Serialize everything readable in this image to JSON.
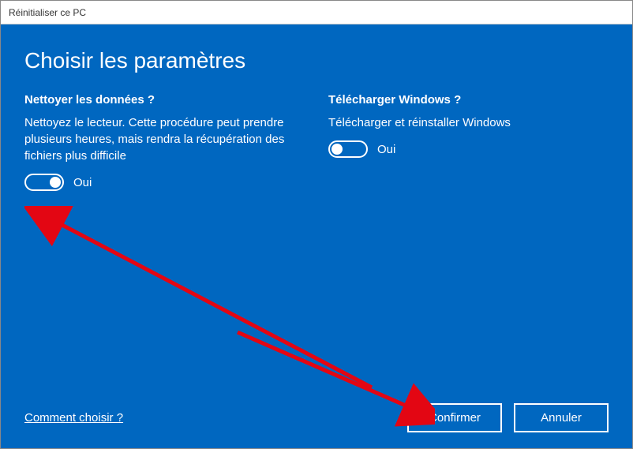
{
  "window": {
    "title": "Réinitialiser ce PC"
  },
  "page": {
    "title": "Choisir les paramètres",
    "help_link": "Comment choisir ?"
  },
  "settings": {
    "clean_data": {
      "heading": "Nettoyer les données ?",
      "description": "Nettoyez le lecteur. Cette procédure peut prendre plusieurs heures, mais rendra la récupération des fichiers plus difficile",
      "value_label": "Oui"
    },
    "download_windows": {
      "heading": "Télécharger Windows ?",
      "description": "Télécharger et réinstaller Windows",
      "value_label": "Oui"
    }
  },
  "buttons": {
    "confirm": "Confirmer",
    "cancel": "Annuler"
  }
}
